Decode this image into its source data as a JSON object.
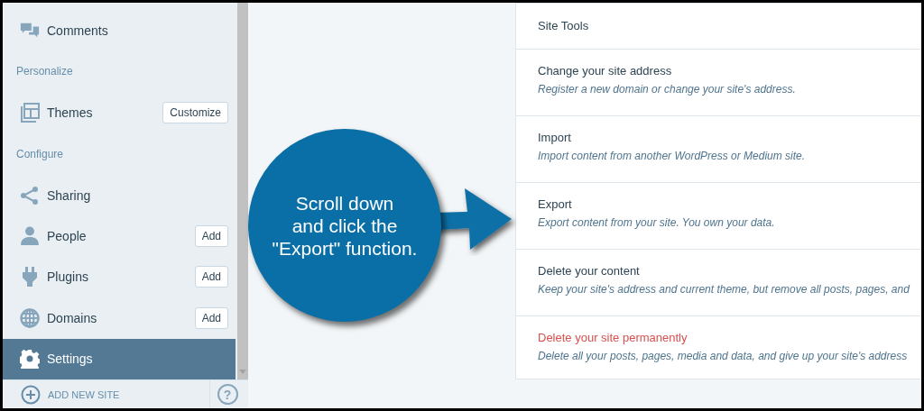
{
  "sidebar": {
    "items": [
      {
        "kind": "item",
        "label": "Comments",
        "selected": false
      },
      {
        "kind": "header",
        "label": "Personalize"
      },
      {
        "kind": "item",
        "label": "Themes",
        "button": "Customize",
        "selected": false
      },
      {
        "kind": "header",
        "label": "Configure"
      },
      {
        "kind": "item",
        "label": "Sharing",
        "selected": false
      },
      {
        "kind": "item",
        "label": "People",
        "button": "Add",
        "selected": false
      },
      {
        "kind": "item",
        "label": "Plugins",
        "button": "Add",
        "selected": false
      },
      {
        "kind": "item",
        "label": "Domains",
        "button": "Add",
        "selected": false
      },
      {
        "kind": "item",
        "label": "Settings",
        "selected": true
      }
    ],
    "footer": {
      "add_site": "ADD NEW SITE",
      "help": "?"
    }
  },
  "site_tools": {
    "title": "Site Tools",
    "rows": [
      {
        "title": "Change your site address",
        "description": "Register a new domain or change your site's address.",
        "danger": false
      },
      {
        "title": "Import",
        "description": "Import content from another WordPress or Medium site.",
        "danger": false
      },
      {
        "title": "Export",
        "description": "Export content from your site. You own your data.",
        "danger": false
      },
      {
        "title": "Delete your content",
        "description": "Keep your site's address and current theme, but remove all posts, pages, and",
        "danger": false
      },
      {
        "title": "Delete your site permanently",
        "description": "Delete all your posts, pages, media and data, and give up your site's address",
        "danger": true
      }
    ]
  },
  "callout": {
    "lines": [
      "Scroll down",
      "and click the",
      "\"Export\" function."
    ]
  }
}
